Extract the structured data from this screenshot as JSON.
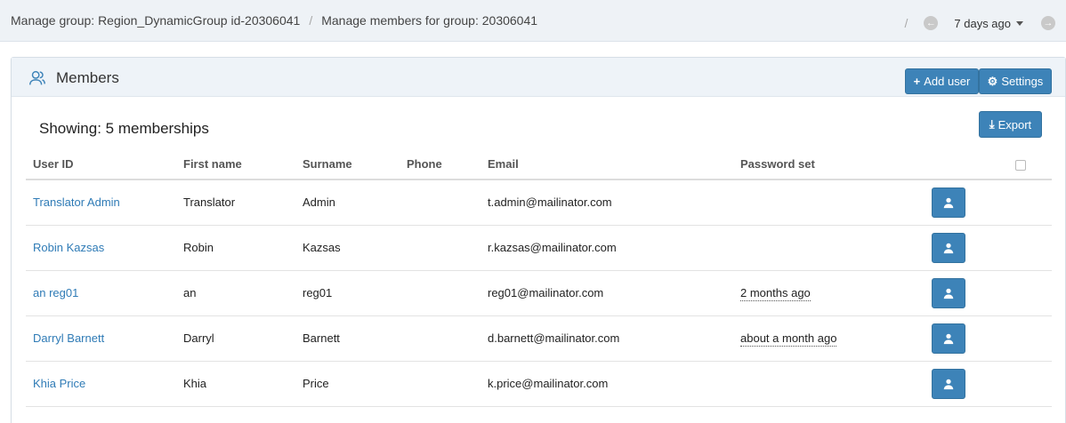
{
  "breadcrumbs": [
    "Manage group: Region_DynamicGroup id-20306041",
    "Manage members for group: 20306041"
  ],
  "separator": "/",
  "date_range": "7 days ago",
  "panel": {
    "title": "Members",
    "add_user_label": "Add user",
    "settings_label": "Settings",
    "export_label": "Export",
    "showing": "Showing: 5 memberships"
  },
  "table": {
    "headers": [
      "User ID",
      "First name",
      "Surname",
      "Phone",
      "Email",
      "Password set"
    ],
    "rows": [
      {
        "user_id": "Translator Admin",
        "first": "Translator",
        "surname": "Admin",
        "phone": "",
        "email": "t.admin@mailinator.com",
        "password_set": ""
      },
      {
        "user_id": "Robin Kazsas",
        "first": "Robin",
        "surname": "Kazsas",
        "phone": "",
        "email": "r.kazsas@mailinator.com",
        "password_set": ""
      },
      {
        "user_id": "an reg01",
        "first": "an",
        "surname": "reg01",
        "phone": "",
        "email": "reg01@mailinator.com",
        "password_set": "2 months ago"
      },
      {
        "user_id": "Darryl Barnett",
        "first": "Darryl",
        "surname": "Barnett",
        "phone": "",
        "email": "d.barnett@mailinator.com",
        "password_set": "about a month ago"
      },
      {
        "user_id": "Khia Price",
        "first": "Khia",
        "surname": "Price",
        "phone": "",
        "email": "k.price@mailinator.com",
        "password_set": ""
      }
    ]
  },
  "colors": {
    "accent": "#3d83b8",
    "link": "#2f7bb6",
    "header_bg": "#eef2f6"
  },
  "icons": {
    "members": "users-icon",
    "back": "arrow-left-circle-icon",
    "forward": "arrow-right-circle-icon",
    "user_action": "user-icon",
    "settings": "gear-icon",
    "export": "download-icon",
    "add": "plus-icon"
  }
}
